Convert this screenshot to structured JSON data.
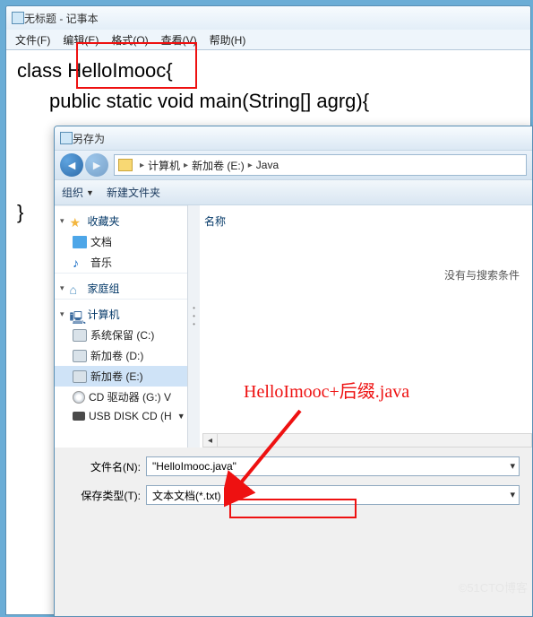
{
  "notepad": {
    "title": "无标题 - 记事本",
    "menu": {
      "file": "文件(F)",
      "edit": "编辑(E)",
      "format": "格式(O)",
      "view": "查看(V)",
      "help": "帮助(H)"
    },
    "code": {
      "l1a": "class ",
      "l1b": "HelloImooc",
      "l1c": "{",
      "l2": "public static void main(String[] agrg){",
      "l3": "}"
    }
  },
  "saveas": {
    "title": "另存为",
    "breadcrumb": {
      "p1": "计算机",
      "p2": "新加卷 (E:)",
      "p3": "Java"
    },
    "toolbar": {
      "org": "组织",
      "newfolder": "新建文件夹"
    },
    "tree": {
      "fav": "收藏夹",
      "doc": "文档",
      "music": "音乐",
      "home": "家庭组",
      "computer": "计算机",
      "sys": "系统保留 (C:)",
      "d": "新加卷 (D:)",
      "e": "新加卷 (E:)",
      "g": "CD 驱动器 (G:) V",
      "usb": "USB DISK CD (H"
    },
    "list": {
      "col_name": "名称",
      "empty": "没有与搜索条件"
    },
    "filename_label": "文件名(N):",
    "filename_value": "\"HelloImooc.java\"",
    "savetype_label": "保存类型(T):",
    "savetype_value": "文本文档(*.txt)"
  },
  "annotation": "HelloImooc+后缀.java",
  "watermark": "©51CTO博客"
}
